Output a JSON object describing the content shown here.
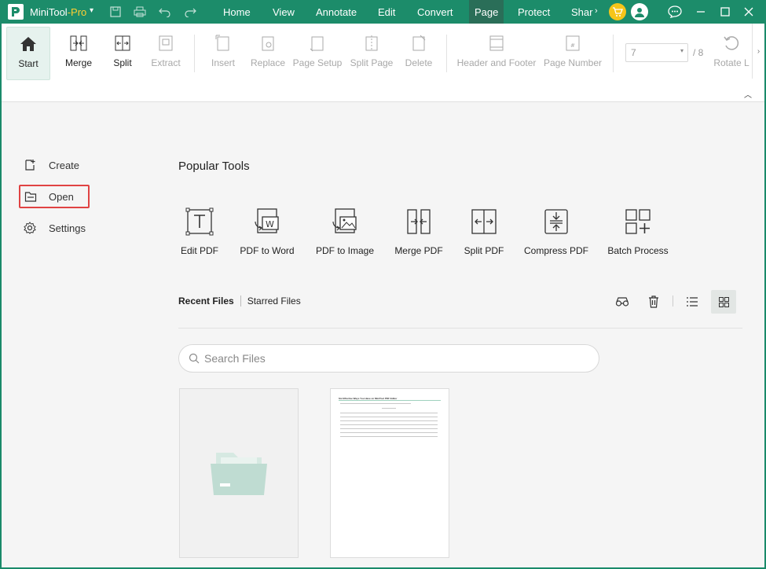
{
  "app": {
    "name": "MiniTool",
    "edition": "-Pro"
  },
  "menu": [
    {
      "label": "Home"
    },
    {
      "label": "View"
    },
    {
      "label": "Annotate"
    },
    {
      "label": "Edit"
    },
    {
      "label": "Convert"
    },
    {
      "label": "Page"
    },
    {
      "label": "Protect"
    },
    {
      "label": "Shar"
    }
  ],
  "ribbon": {
    "start": "Start",
    "merge": "Merge",
    "split": "Split",
    "extract": "Extract",
    "insert": "Insert",
    "replace": "Replace",
    "page_setup": "Page Setup",
    "split_page": "Split Page",
    "delete": "Delete",
    "header_footer": "Header and Footer",
    "page_number": "Page Number",
    "page_value": "7",
    "page_total": "/ 8",
    "rotate": "Rotate L"
  },
  "sidebar": {
    "create": "Create",
    "open": "Open",
    "settings": "Settings"
  },
  "popular": {
    "title": "Popular Tools",
    "tools": [
      {
        "label": "Edit PDF"
      },
      {
        "label": "PDF to Word"
      },
      {
        "label": "PDF to Image"
      },
      {
        "label": "Merge PDF"
      },
      {
        "label": "Split PDF"
      },
      {
        "label": "Compress PDF"
      },
      {
        "label": "Batch Process"
      }
    ]
  },
  "files": {
    "recent_tab": "Recent Files",
    "starred_tab": "Starred Files",
    "search_placeholder": "Search Files",
    "doc_title": "Six Effective Ways You Have on MiniTool PDF Editor"
  },
  "colors": {
    "brand": "#1c8c6a",
    "highlight": "#e04343",
    "folder": "#bfdcd2"
  }
}
